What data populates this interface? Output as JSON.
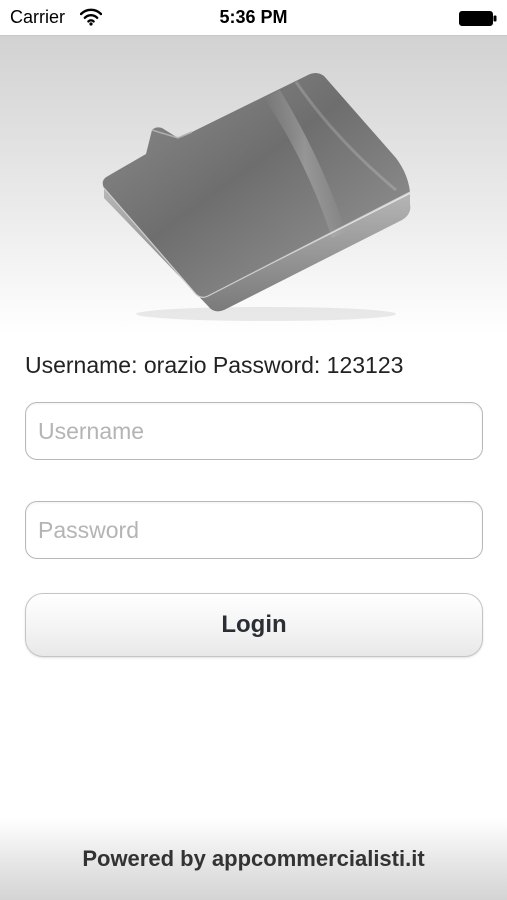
{
  "status_bar": {
    "carrier": "Carrier",
    "time": "5:36 PM",
    "wifi_icon": "wifi-icon",
    "battery_icon": "battery-icon"
  },
  "hero": {
    "icon": "folder-icon"
  },
  "credentials_hint": "Username: orazio Password: 123123",
  "login_form": {
    "username_placeholder": "Username",
    "password_placeholder": "Password",
    "login_label": "Login"
  },
  "footer": {
    "text": "Powered by appcommercialisti.it"
  },
  "colors": {
    "text": "#222222",
    "placeholder": "#b4b4b4",
    "button_text": "#2a2f36",
    "border": "#b8b8b8"
  }
}
